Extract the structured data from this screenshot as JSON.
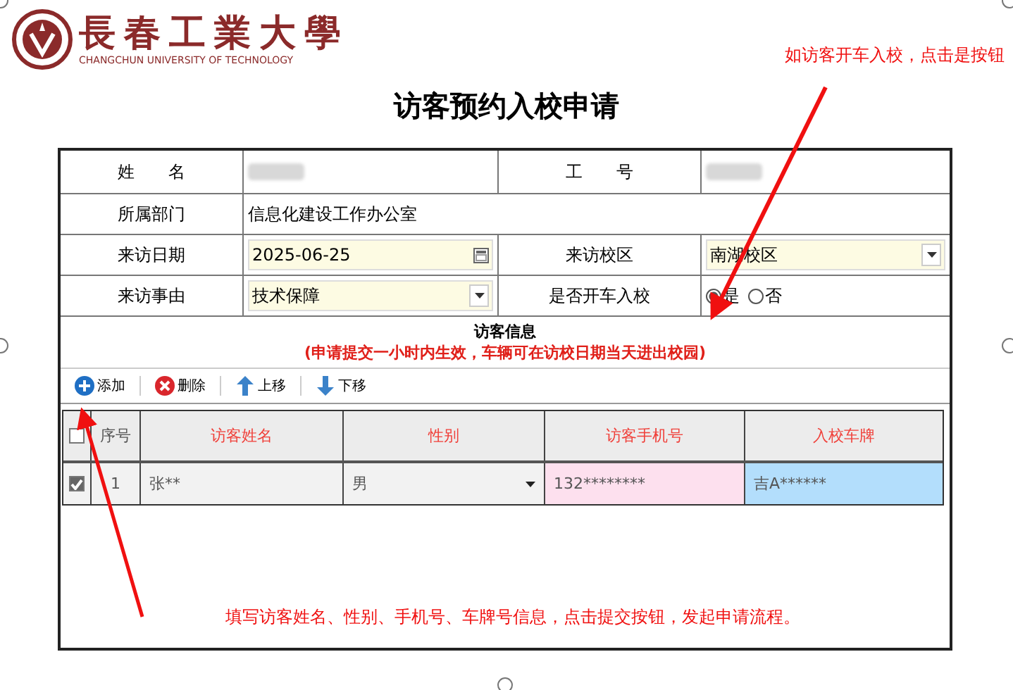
{
  "logo": {
    "name": "長春工業大學",
    "subtitle": "CHANGCHUN UNIVERSITY OF TECHNOLOGY"
  },
  "title": "访客预约入校申请",
  "form": {
    "rows": [
      [
        {
          "label": "姓　　名",
          "kind": "blurred"
        },
        {
          "label": "工　　号",
          "kind": "blurred"
        }
      ],
      [
        {
          "label": "所属部门",
          "kind": "text",
          "value": "信息化建设工作办公室"
        }
      ],
      [
        {
          "label": "来访日期",
          "kind": "date",
          "value": "2025-06-25"
        },
        {
          "label": "来访校区",
          "kind": "select",
          "value": "南湖校区"
        }
      ],
      [
        {
          "label": "来访事由",
          "kind": "select",
          "value": "技术保障"
        },
        {
          "label": "是否开车入校",
          "kind": "radio",
          "options": [
            {
              "label": "是",
              "selected": true
            },
            {
              "label": "否",
              "selected": false
            }
          ]
        }
      ]
    ]
  },
  "section": {
    "title": "访客信息",
    "note": "(申请提交一小时内生效，车辆可在访校日期当天进出校园)"
  },
  "toolbar": [
    {
      "label": "添加",
      "kind": "add"
    },
    {
      "label": "删除",
      "kind": "delete"
    },
    {
      "label": "上移",
      "kind": "up"
    },
    {
      "label": "下移",
      "kind": "down"
    }
  ],
  "grid": {
    "all_checked": false,
    "columns": [
      "序号",
      "访客姓名",
      "性别",
      "访客手机号",
      "入校车牌"
    ],
    "rows": [
      {
        "checked": true,
        "cells": [
          "1",
          "张**",
          "男",
          "132********",
          "吉A******"
        ]
      }
    ]
  },
  "annotations": [
    {
      "text": "如访客开车入校，点击是按钮"
    },
    {
      "text": "填写访客姓名、性别、手机号、车牌号信息，点击提交按钮，发起申请流程。"
    }
  ]
}
